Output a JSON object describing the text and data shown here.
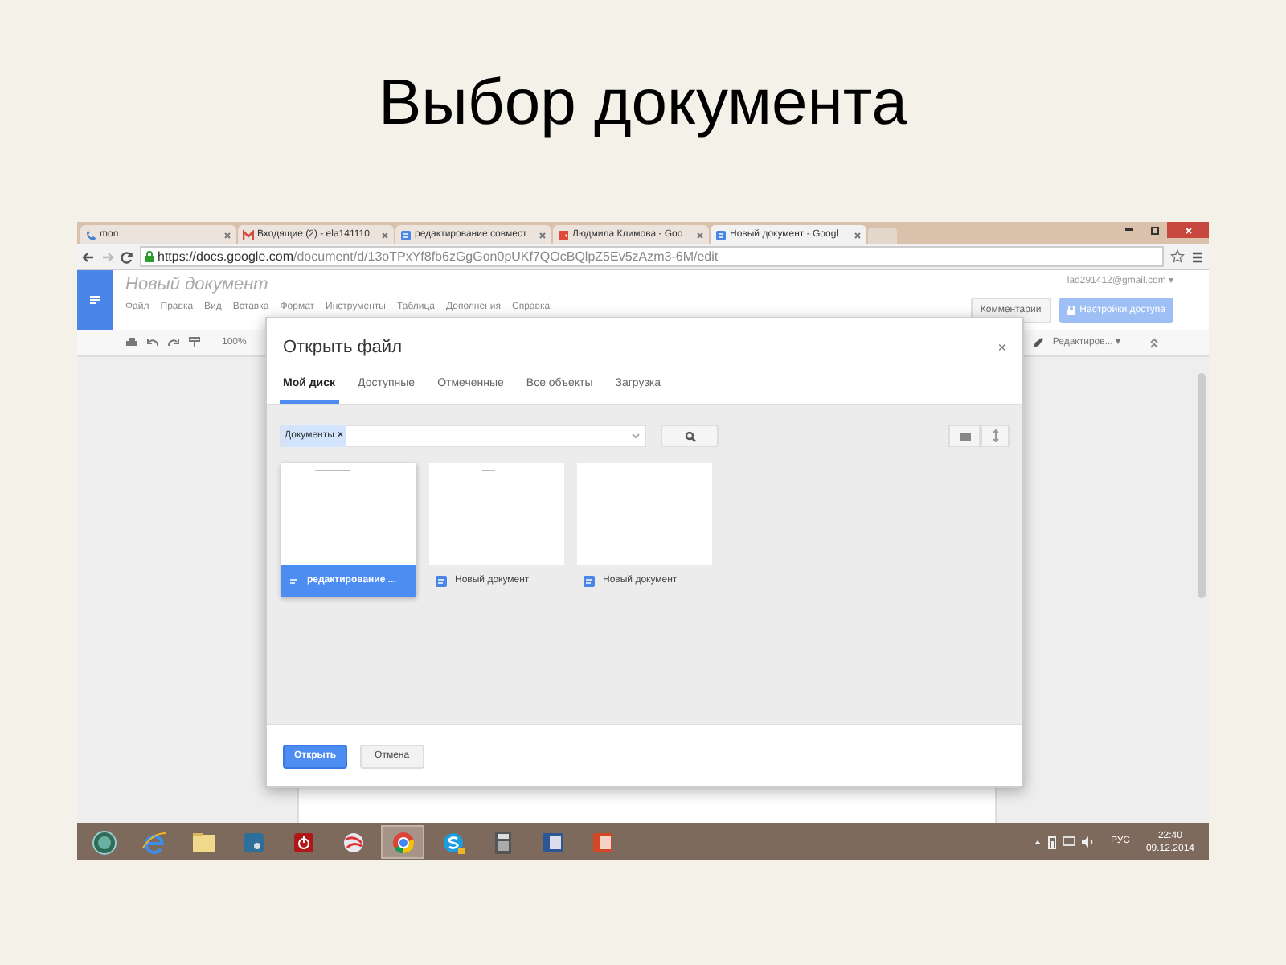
{
  "slide_title": "Выбор документа",
  "browser": {
    "tabs": [
      {
        "kind": "phone",
        "label": "mon",
        "selected": false
      },
      {
        "kind": "mail",
        "label": "Входящие (2) - ela141110",
        "selected": false
      },
      {
        "kind": "docs",
        "label": "редактирование совмест",
        "selected": false
      },
      {
        "kind": "gplus",
        "label": "Людмила Климова - Goo",
        "selected": false
      },
      {
        "kind": "docs",
        "label": "Новый документ - Googl",
        "selected": true
      }
    ],
    "url_host": "https://docs.google.com",
    "url_path": "/document/d/13oTPxYf8fb6zGgGon0pUKf7QOcBQlpZ5Ev5zAzm3-6M/edit"
  },
  "docs": {
    "title": "Новый документ",
    "menu": [
      "Файл",
      "Правка",
      "Вид",
      "Вставка",
      "Формат",
      "Инструменты",
      "Таблица",
      "Дополнения",
      "Справка"
    ],
    "account": "lad291412@gmail.com ▾",
    "comments_button": "Комментарии",
    "share_button": "Настройки доступа",
    "zoom": "100%",
    "mode": "Редактиров... ▾"
  },
  "dialog": {
    "title": "Открыть файл",
    "close": "×",
    "tabs": [
      {
        "label": "Мой диск",
        "selected": true
      },
      {
        "label": "Доступные",
        "selected": false
      },
      {
        "label": "Отмеченные",
        "selected": false
      },
      {
        "label": "Все объекты",
        "selected": false
      },
      {
        "label": "Загрузка",
        "selected": false
      }
    ],
    "filter_chip": "Документы",
    "filter_chip_close": "×",
    "files": [
      {
        "name": "редактирование ...",
        "selected": true,
        "kind": "text"
      },
      {
        "name": "Новый документ",
        "selected": false,
        "kind": "short"
      },
      {
        "name": "Новый документ",
        "selected": false,
        "kind": "blank"
      }
    ],
    "open_button": "Открыть",
    "cancel_button": "Отмена"
  },
  "taskbar": {
    "apps": [
      {
        "kind": "start",
        "selected": false
      },
      {
        "kind": "ie",
        "selected": false
      },
      {
        "kind": "folder",
        "selected": false
      },
      {
        "kind": "tile",
        "selected": false
      },
      {
        "kind": "power",
        "selected": false
      },
      {
        "kind": "ball",
        "selected": false
      },
      {
        "kind": "chrome",
        "selected": true
      },
      {
        "kind": "skype",
        "selected": false
      },
      {
        "kind": "calc",
        "selected": false
      },
      {
        "kind": "word",
        "selected": false
      },
      {
        "kind": "ppt",
        "selected": false
      }
    ],
    "language": "РУС",
    "time": "22:40",
    "date": "09.12.2014"
  }
}
